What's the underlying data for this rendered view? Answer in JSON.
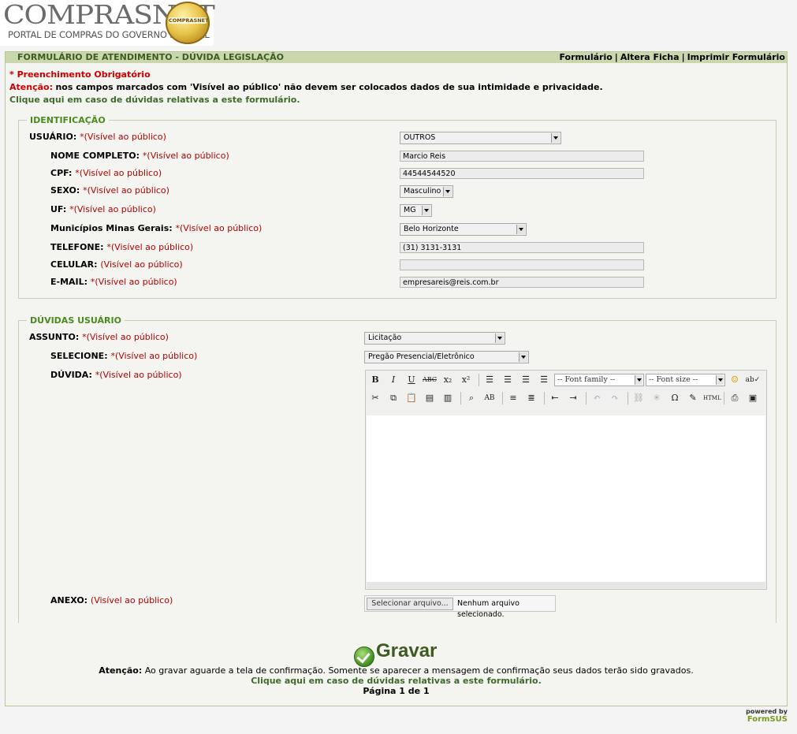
{
  "logo": {
    "word": "COMPRASNET",
    "subtitle": "PORTAL DE COMPRAS DO GOVERNO FEDERAL",
    "seal_text": "COMPRASNET"
  },
  "header": {
    "title": "FORMULÁRIO DE ATENDIMENTO - DÚVIDA LEGISLAÇÃO",
    "links": [
      "Formulário",
      "Altera Ficha",
      "Imprimir Formulário"
    ]
  },
  "notes": {
    "required": "* Preenchimento Obrigatório",
    "attention_label": "Atenção:",
    "attention_text": "nos campos marcados com 'Visível ao público' não devem ser colocados dados de sua intimidade e privacidade.",
    "help_link": "Clique aqui em caso de dúvidas relativas a este formulário."
  },
  "identificacao": {
    "legend": "IDENTIFICAÇÃO",
    "usuario": {
      "label": "USUÁRIO:",
      "vis": "*(Visível ao público)",
      "value": "OUTROS"
    },
    "nome": {
      "label": "NOME COMPLETO:",
      "vis": "*(Visível ao público)",
      "value": "Marcio Reis"
    },
    "cpf": {
      "label": "CPF:",
      "vis": "*(Visível ao público)",
      "value": "44544544520"
    },
    "sexo": {
      "label": "SEXO:",
      "vis": "*(Visível ao público)",
      "value": "Masculino"
    },
    "uf": {
      "label": "UF:",
      "vis": "*(Visível ao público)",
      "value": "MG"
    },
    "municipio": {
      "label": "Municípios Minas Gerais:",
      "vis": "*(Visível ao público)",
      "value": "Belo Horizonte"
    },
    "telefone": {
      "label": "TELEFONE:",
      "vis": "*(Visível ao público)",
      "value": "(31) 3131-3131"
    },
    "celular": {
      "label": "CELULAR:",
      "vis": "(Visível ao público)",
      "value": ""
    },
    "email": {
      "label": "E-MAIL:",
      "vis": "*(Visível ao público)",
      "value": "empresareis@reis.com.br"
    }
  },
  "duvidas": {
    "legend": "DÚVIDAS USUÁRIO",
    "assunto": {
      "label": "ASSUNTO:",
      "vis": "*(Visível ao público)",
      "value": "Licitação"
    },
    "selecione": {
      "label": "SELECIONE:",
      "vis": "*(Visível ao público)",
      "value": "Pregão Presencial/Eletrônico"
    },
    "duvida": {
      "label": "DÚVIDA:",
      "vis": "*(Visível ao público)"
    },
    "anexo": {
      "label": "ANEXO:",
      "vis": "(Visível ao público)",
      "button": "Selecionar arquivo...",
      "status": "Nenhum arquivo selecionado."
    },
    "editor": {
      "font_family": "-- Font family --",
      "font_size": "-- Font size --",
      "html": "HTML"
    }
  },
  "footer": {
    "save_label": "Gravar",
    "attention_label": "Atenção:",
    "attention_text": "Ao gravar aguarde a tela de confirmação. Somente se aparecer a mensagem de confirmação seus dados terão sido gravados.",
    "help_link": "Clique aqui em caso de dúvidas relativas a este formulário.",
    "page": "Página 1 de 1",
    "powered1": "powered by",
    "powered2": "FormSUS"
  }
}
